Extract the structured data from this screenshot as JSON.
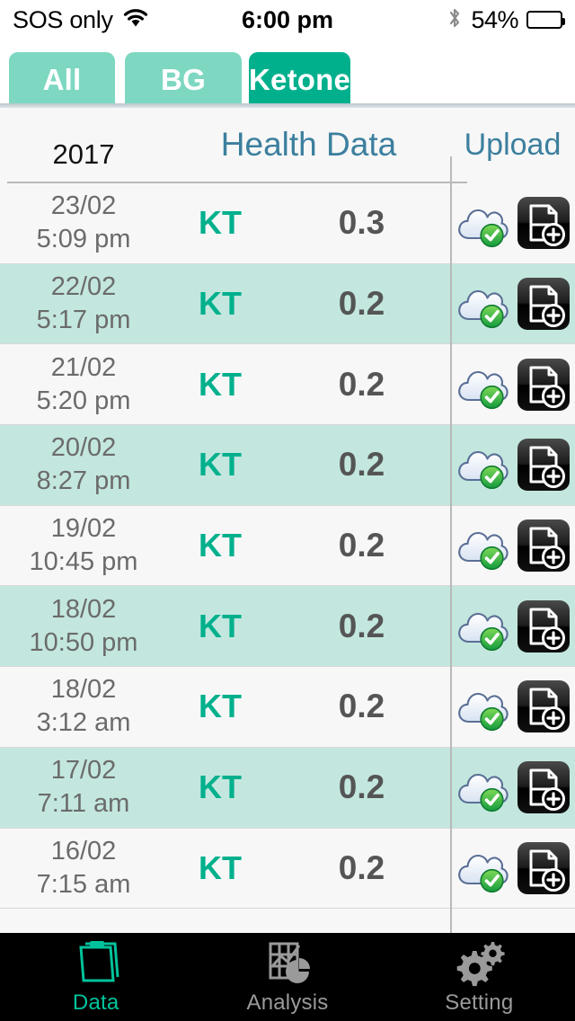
{
  "status_bar": {
    "carrier": "SOS only",
    "wifi_icon": "wifi-icon",
    "time": "6:00 pm",
    "bluetooth_icon": "bluetooth-icon",
    "battery_percent": "54%",
    "battery_level": 60
  },
  "tabs": [
    {
      "label": "All",
      "active": false
    },
    {
      "label": "BG",
      "active": false
    },
    {
      "label": "Ketone",
      "active": true
    }
  ],
  "list_header": {
    "year": "2017",
    "title": "Health Data",
    "upload": "Upload"
  },
  "rows": [
    {
      "date": "23/02",
      "time": "5:09 pm",
      "type": "KT",
      "value": "0.3",
      "cloud_icon": "cloud-uploaded-icon",
      "doc_icon": "add-document-icon"
    },
    {
      "date": "22/02",
      "time": "5:17 pm",
      "type": "KT",
      "value": "0.2",
      "cloud_icon": "cloud-uploaded-icon",
      "doc_icon": "add-document-icon"
    },
    {
      "date": "21/02",
      "time": "5:20 pm",
      "type": "KT",
      "value": "0.2",
      "cloud_icon": "cloud-uploaded-icon",
      "doc_icon": "add-document-icon"
    },
    {
      "date": "20/02",
      "time": "8:27 pm",
      "type": "KT",
      "value": "0.2",
      "cloud_icon": "cloud-uploaded-icon",
      "doc_icon": "add-document-icon"
    },
    {
      "date": "19/02",
      "time": "10:45 pm",
      "type": "KT",
      "value": "0.2",
      "cloud_icon": "cloud-uploaded-icon",
      "doc_icon": "add-document-icon"
    },
    {
      "date": "18/02",
      "time": "10:50 pm",
      "type": "KT",
      "value": "0.2",
      "cloud_icon": "cloud-uploaded-icon",
      "doc_icon": "add-document-icon"
    },
    {
      "date": "18/02",
      "time": "3:12 am",
      "type": "KT",
      "value": "0.2",
      "cloud_icon": "cloud-uploaded-icon",
      "doc_icon": "add-document-icon"
    },
    {
      "date": "17/02",
      "time": "7:11 am",
      "type": "KT",
      "value": "0.2",
      "cloud_icon": "cloud-uploaded-icon",
      "doc_icon": "add-document-icon"
    },
    {
      "date": "16/02",
      "time": "7:15 am",
      "type": "KT",
      "value": "0.2",
      "cloud_icon": "cloud-uploaded-icon",
      "doc_icon": "add-document-icon"
    }
  ],
  "bottom_nav": [
    {
      "label": "Data",
      "icon": "clipboard-icon",
      "active": true
    },
    {
      "label": "Analysis",
      "icon": "chart-pie-icon",
      "active": false
    },
    {
      "label": "Setting",
      "icon": "gears-icon",
      "active": false
    }
  ],
  "colors": {
    "tab_active": "#00b08d",
    "tab_inactive": "#7ed8c1",
    "accent_teal": "#00b08d",
    "title_blue": "#3c7f9e",
    "row_stripe": "#c3e7de",
    "row_plain": "#f7f7f7",
    "nav_bar": "#000000",
    "nav_active": "#00c39c"
  }
}
